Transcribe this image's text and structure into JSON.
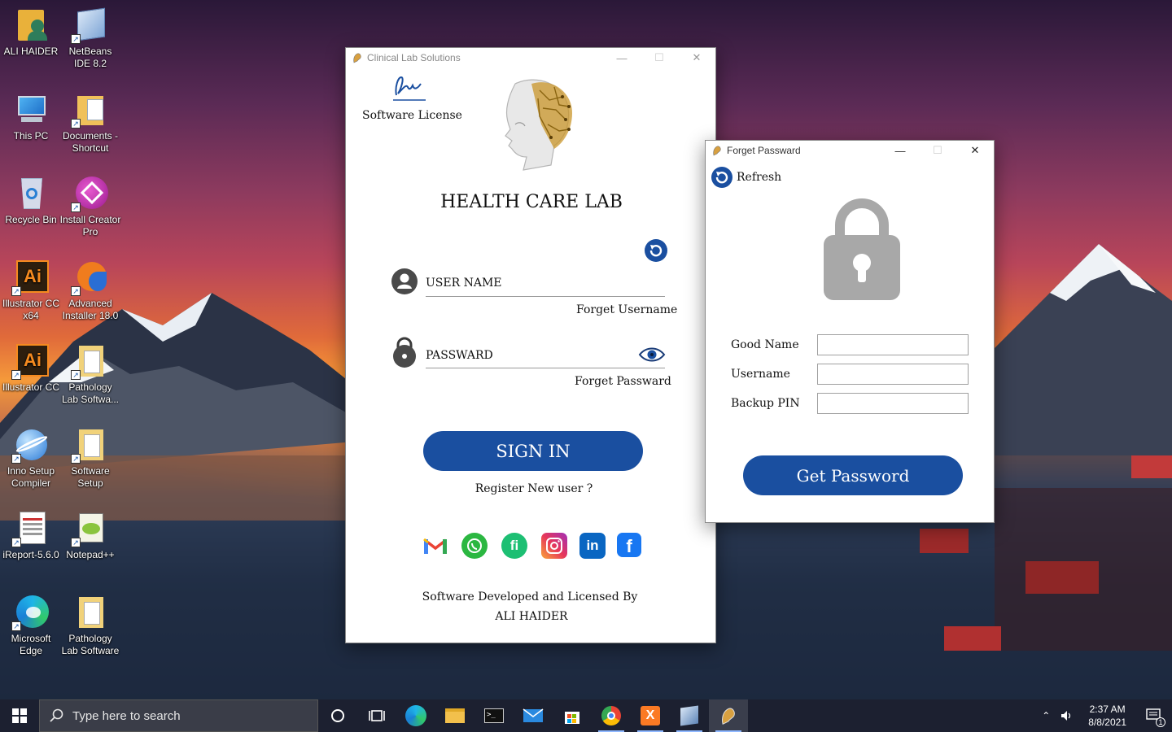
{
  "desktop": {
    "icons": [
      {
        "label": "ALI HAIDER"
      },
      {
        "label": "NetBeans IDE 8.2"
      },
      {
        "label": "This PC"
      },
      {
        "label": "Documents - Shortcut"
      },
      {
        "label": "Recycle Bin"
      },
      {
        "label": "Install Creator Pro"
      },
      {
        "label": "Illustrator CC x64"
      },
      {
        "label": "Advanced Installer 18.0"
      },
      {
        "label": "Illustrator CC"
      },
      {
        "label": "Pathology Lab Softwa..."
      },
      {
        "label": "Inno Setup Compiler"
      },
      {
        "label": "Software Setup"
      },
      {
        "label": "iReport-5.6.0"
      },
      {
        "label": "Notepad++"
      },
      {
        "label": "Microsoft Edge"
      },
      {
        "label": "Pathology Lab Software"
      }
    ]
  },
  "login_window": {
    "title": "Clinical Lab Solutions",
    "license_label": "Software License",
    "heading": "HEALTH CARE LAB",
    "username_placeholder": "USER NAME",
    "forget_username": "Forget Username",
    "password_placeholder": "PASSWARD",
    "forget_password": "Forget Passward",
    "sign_in": "SIGN IN",
    "register": "Register New user ?",
    "footer_line1": "Software Developed and Licensed By",
    "footer_line2": "ALI HAIDER",
    "social_icons": [
      "gmail-icon",
      "whatsapp-icon",
      "fiverr-icon",
      "instagram-icon",
      "linkedin-icon",
      "facebook-icon"
    ]
  },
  "forget_window": {
    "title": "Forget Passward",
    "refresh": "Refresh",
    "good_name_label": "Good Name",
    "username_label": "Username",
    "backup_pin_label": "Backup PIN",
    "good_name_value": "",
    "username_value": "",
    "backup_pin_value": "",
    "get_password": "Get Password"
  },
  "taskbar": {
    "search_placeholder": "Type here to search",
    "time": "2:37 AM",
    "date": "8/8/2021",
    "notification_count": "1"
  },
  "colors": {
    "accent_blue": "#1a4fa0"
  }
}
